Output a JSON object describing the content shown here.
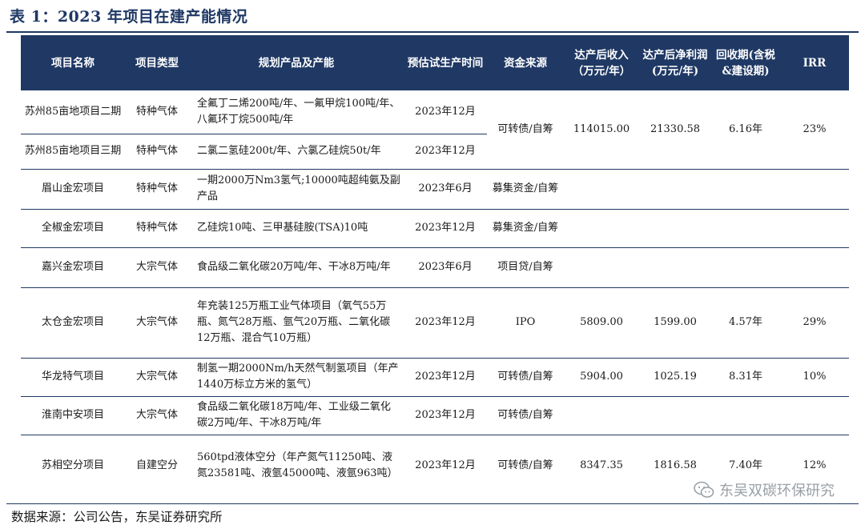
{
  "title": "表 1：2023 年项目在建产能情况",
  "headers": [
    "项目名称",
    "项目类型",
    "规划产品及产能",
    "预估试生产时间",
    "资金来源",
    "达产后收入（万元/年）",
    "达产后净利润(万元/年)",
    "回收期(含税&建设期)",
    "IRR"
  ],
  "rows": [
    {
      "name": "苏州85亩地项目二期",
      "type": "特种气体",
      "product": "全氟丁二烯200吨/年、一氟甲烷100吨/年、八氟环丁烷500吨/年",
      "time": "2023年12月"
    },
    {
      "name": "苏州85亩地项目三期",
      "type": "特种气体",
      "product": "二氯二氢硅200t/年、六氯乙硅烷50t/年",
      "time": "2023年12月"
    },
    {
      "name": "眉山金宏项目",
      "type": "特种气体",
      "product": "一期2000万Nm3氢气;10000吨超纯氨及副产品",
      "time": "2023年6月",
      "fund": "募集资金/自筹"
    },
    {
      "name": "全椒金宏项目",
      "type": "特种气体",
      "product": "乙硅烷10吨、三甲基硅胺(TSA)10吨",
      "time": "2023年12月",
      "fund": "募集资金/自筹"
    },
    {
      "name": "嘉兴金宏项目",
      "type": "大宗气体",
      "product": "食品级二氧化碳20万吨/年、干冰8万吨/年",
      "time": "2023年6月",
      "fund": "项目贷/自筹"
    },
    {
      "name": "太仓金宏项目",
      "type": "大宗气体",
      "product": "年充装125万瓶工业气体项目（氧气55万瓶、氮气28万瓶、氩气20万瓶、二氧化碳12万瓶、混合气10万瓶）",
      "time": "2023年12月",
      "fund": "IPO",
      "revenue": "5809.00",
      "profit": "1599.00",
      "payback": "4.57年",
      "irr": "29%"
    },
    {
      "name": "华龙特气项目",
      "type": "大宗气体",
      "product": "制氢一期2000Nm/h天然气制氢项目（年产1440万标立方米的氢气）",
      "time": "2023年12月",
      "fund": "可转债/自筹",
      "revenue": "5904.00",
      "profit": "1025.19",
      "payback": "8.31年",
      "irr": "10%"
    },
    {
      "name": "淮南中安项目",
      "type": "大宗气体",
      "product": "食品级二氧化碳18万吨/年、工业级二氧化碳2万吨/年、干冰8万吨/年",
      "time": "2023年12月",
      "fund": "可转债/自筹"
    },
    {
      "name": "苏相空分项目",
      "type": "自建空分",
      "product": "560tpd液体空分（年产氮气11250吨、液氮23581吨、液氩45000吨、液氩963吨）",
      "time": "2023年12月",
      "fund": "可转债/自筹",
      "revenue": "8347.35",
      "profit": "1816.58",
      "payback": "7.40年",
      "irr": "12%"
    }
  ],
  "suzhou_merged": {
    "fund": "可转债/自筹",
    "revenue": "114015.00",
    "profit": "21330.58",
    "payback": "6.16年",
    "irr": "23%"
  },
  "source": "数据来源：公司公告，东吴证券研究所",
  "watermark": "东吴双碳环保研究"
}
